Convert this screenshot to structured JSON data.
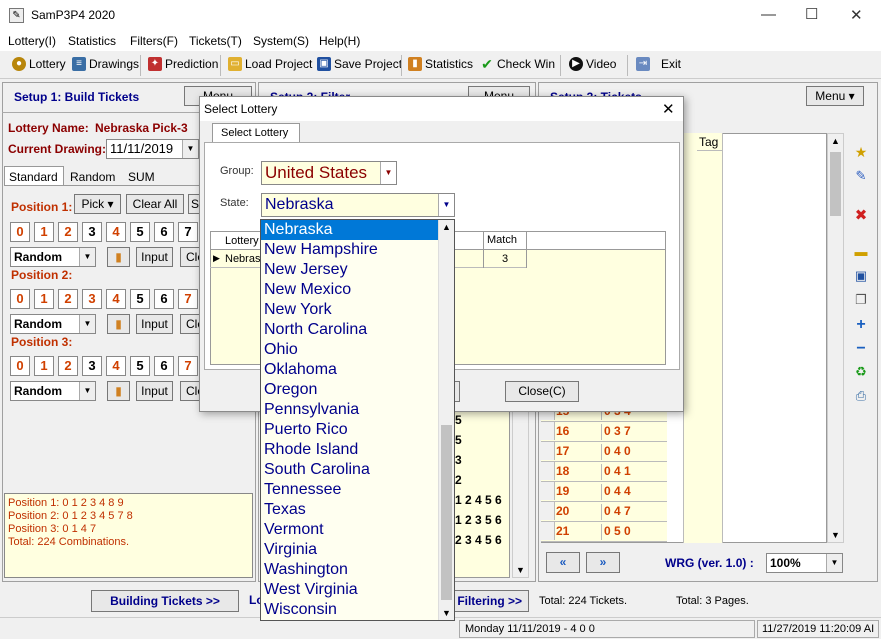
{
  "window": {
    "title": "SamP3P4 2020",
    "minimize_icon": "minimize-icon",
    "maximize_icon": "maximize-icon",
    "close_icon": "close-icon"
  },
  "menu": [
    "Lottery(I)",
    "Statistics",
    "Filters(F)",
    "Tickets(T)",
    "System(S)",
    "Help(H)"
  ],
  "toolbar": {
    "lottery": "Lottery",
    "drawings": "Drawings",
    "prediction": "Prediction",
    "load_project": "Load Project",
    "save_project": "Save Project",
    "statistics": "Statistics",
    "check_win": "Check Win",
    "video": "Video",
    "exit": "Exit"
  },
  "setup1": {
    "title": "Setup 1: Build  Tickets",
    "menu_label": "Menu",
    "lottery_label": "Lottery  Name:",
    "lottery_name": "Nebraska Pick-3",
    "current_drawing_label": "Current Drawing:",
    "current_drawing": "11/11/2019",
    "tabs": [
      "Standard",
      "Random",
      "SUM"
    ],
    "positions": [
      {
        "label": "Position 1:",
        "digits": [
          "0",
          "1",
          "2",
          "3",
          "4",
          "5",
          "6",
          "7"
        ],
        "mode": "Random"
      },
      {
        "label": "Position 2:",
        "digits": [
          "0",
          "1",
          "2",
          "3",
          "4",
          "5",
          "6",
          "7"
        ],
        "mode": "Random"
      },
      {
        "label": "Position 3:",
        "digits": [
          "0",
          "1",
          "2",
          "3",
          "4",
          "5",
          "6",
          "7"
        ],
        "mode": "Random"
      }
    ],
    "pick_label": "Pick",
    "clear_all": "Clear All",
    "input_label": "Input",
    "clear_short": "Cle",
    "s_short": "S",
    "info": [
      "Position 1:  0 1 2 3 4 8 9",
      "Position 2:  0 1 2 3 4 5 7 8",
      "Position 3:  0 1 4 7",
      "Total: 224 Combinations."
    ],
    "building_tickets": "Building  Tickets >>",
    "lo_short": "Lo"
  },
  "setup2": {
    "title": "Setup 2: Filter",
    "menu_label": "Menu",
    "filtering": "Filtering  >>",
    "values_right": [
      "5",
      "5",
      "3",
      "2",
      "1 2 4 5 6",
      "1 2 3 5 6",
      "2 3 4 5 6"
    ]
  },
  "setup3": {
    "title": "Setup 3: Tickets",
    "menu_label": "Menu",
    "tag_header": "Tag",
    "rows": [
      {
        "n": "15",
        "v": "0 3 4"
      },
      {
        "n": "16",
        "v": "0 3 7"
      },
      {
        "n": "17",
        "v": "0 4 0"
      },
      {
        "n": "18",
        "v": "0 4 1"
      },
      {
        "n": "19",
        "v": "0 4 4"
      },
      {
        "n": "20",
        "v": "0 4 7"
      },
      {
        "n": "21",
        "v": "0 5 0"
      }
    ],
    "wrg_label": "WRG (ver. 1.0) :",
    "zoom": "100%",
    "total_tickets": "Total: 224 Tickets.",
    "total_pages": "Total: 3 Pages."
  },
  "status": {
    "drawing": "Monday 11/11/2019 - 4 0 0",
    "datetime": "11/27/2019 11:20:09 AI"
  },
  "dialog": {
    "title": "Select Lottery",
    "tab": "Select Lottery",
    "group_label": "Group:",
    "group_value": "United States",
    "state_label": "State:",
    "state_value": "Nebraska",
    "col_lottery": "Lottery",
    "col_match": "Match",
    "row_lottery": "Nebras",
    "row_match": "3",
    "ok_short": ")",
    "close_label": "Close(C)"
  },
  "state_options": [
    "Nebraska",
    "New Hampshire",
    "New Jersey",
    "New Mexico",
    "New York",
    "North Carolina",
    "Ohio",
    "Oklahoma",
    "Oregon",
    "Pennsylvania",
    "Puerto Rico",
    "Rhode Island",
    "South Carolina",
    "Tennessee",
    "Texas",
    "Vermont",
    "Virginia",
    "Washington",
    "West Virginia",
    "Wisconsin"
  ]
}
